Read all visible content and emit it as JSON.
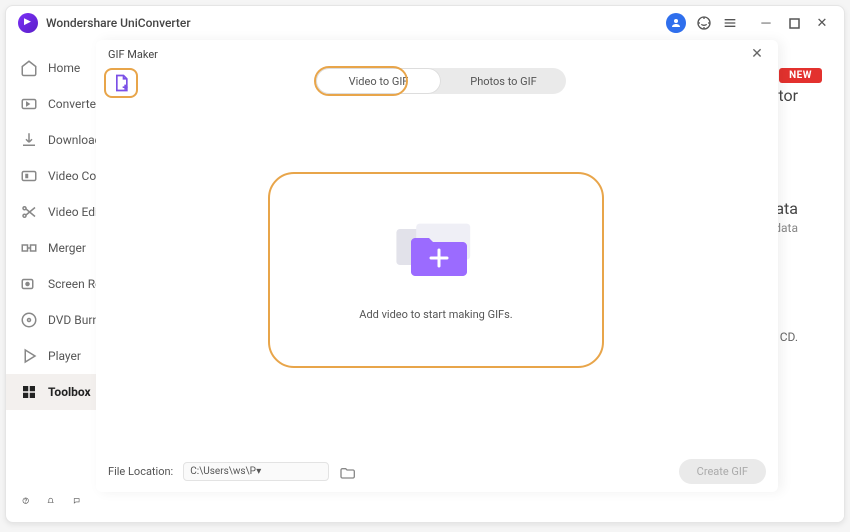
{
  "app": {
    "title": "Wondershare UniConverter"
  },
  "sidebar": {
    "items": [
      {
        "label": "Home"
      },
      {
        "label": "Converter"
      },
      {
        "label": "Downloader"
      },
      {
        "label": "Video Compressor"
      },
      {
        "label": "Video Editor"
      },
      {
        "label": "Merger"
      },
      {
        "label": "Screen Recorder"
      },
      {
        "label": "DVD Burner"
      },
      {
        "label": "Player"
      },
      {
        "label": "Toolbox"
      }
    ]
  },
  "badge": {
    "new": "NEW"
  },
  "bg": {
    "text1": "tor",
    "text2": "data",
    "text3": "etadata",
    "text4": "CD."
  },
  "modal": {
    "title": "GIF Maker",
    "tabs": {
      "video": "Video to GIF",
      "photos": "Photos to GIF"
    },
    "dropText": "Add video to start making GIFs.",
    "fileLocationLabel": "File Location:",
    "fileLocationPath": "C:\\Users\\ws\\Pictures\\Wonders",
    "createBtn": "Create GIF"
  }
}
